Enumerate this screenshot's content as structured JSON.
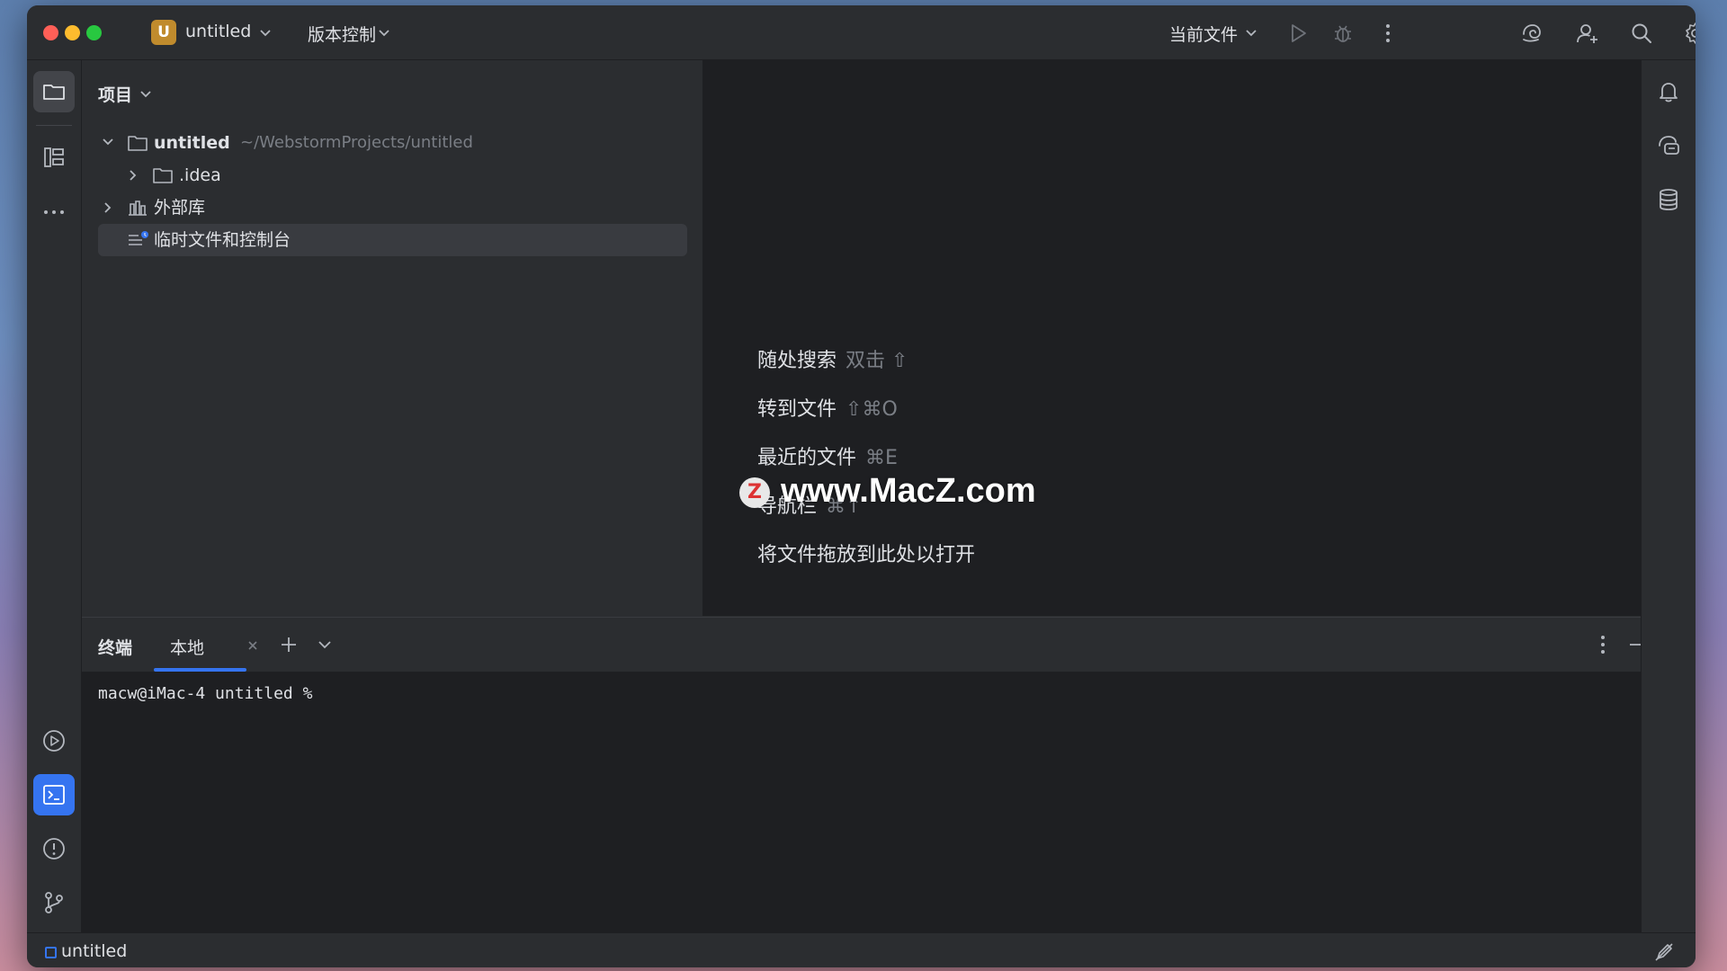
{
  "titlebar": {
    "project_badge": "U",
    "project_name": "untitled",
    "vcs_menu": "版本控制",
    "run_config": "当前文件"
  },
  "project_panel": {
    "title": "项目",
    "tree": [
      {
        "label": "untitled",
        "path": "~/WebstormProjects/untitled"
      },
      {
        "label": ".idea"
      },
      {
        "label": "外部库"
      },
      {
        "label": "临时文件和控制台"
      }
    ]
  },
  "editor": {
    "hints": [
      {
        "label": "随处搜索",
        "key": "双击 ⇧"
      },
      {
        "label": "转到文件",
        "key": "⇧⌘O"
      },
      {
        "label": "最近的文件",
        "key": "⌘E"
      },
      {
        "label": "导航栏",
        "key": "⌘↑"
      },
      {
        "label": "将文件拖放到此处以打开",
        "key": ""
      }
    ],
    "watermark_logo": "Z",
    "watermark": "www.MacZ.com"
  },
  "terminal": {
    "title": "终端",
    "tab_label": "本地",
    "prompt": "macw@iMac-4 untitled %"
  },
  "statusbar": {
    "project": "untitled"
  },
  "colors": {
    "accent": "#3574f0",
    "badge": "#c08b2d",
    "window_bg": "#2b2d30",
    "editor_bg": "#1e1f22"
  },
  "icons": {
    "left_strip": [
      "folder-icon",
      "structure-icon",
      "more-icon",
      "run-icon",
      "terminal-icon",
      "problems-icon",
      "git-icon"
    ],
    "right_strip": [
      "notifications-icon",
      "ai-assistant-icon",
      "database-icon"
    ]
  }
}
